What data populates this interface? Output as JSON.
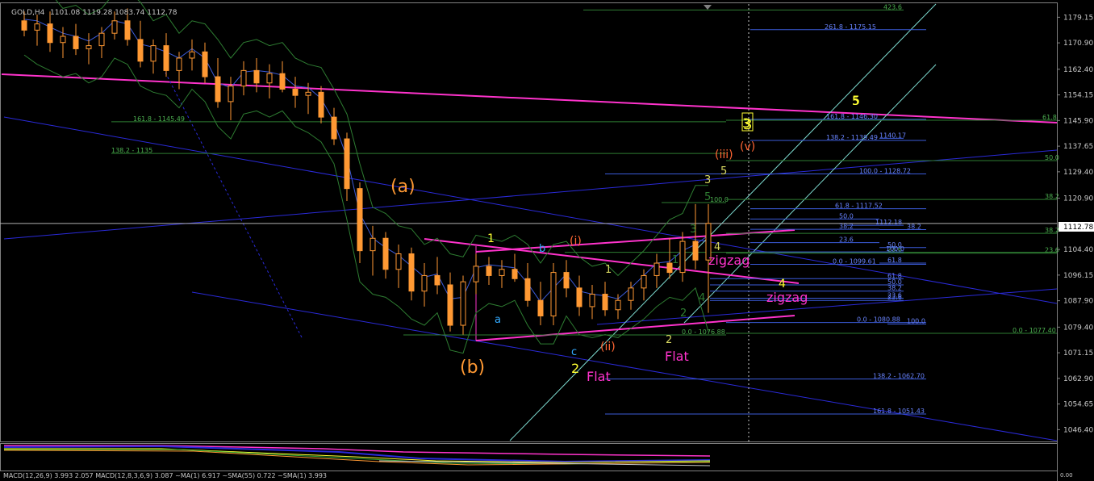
{
  "header": {
    "symbol": "GOLD,H4",
    "ohlc": "1101.08 1119.28 1083.74 1112.78"
  },
  "indicator_label": "MACD(12,26,9) 3.993 2.057  MACD(12,8,3,6,9) 3.087  ~MA(1) 6.917  ~SMA(55) 0.722  ~SMA(1) 3.993",
  "colors": {
    "background": "#000000",
    "candle_up": "#ff9933",
    "candle_down": "#ff9933",
    "magenta": "#ff33cc",
    "blue": "#2a2ad8",
    "fib_green": "#2e7d32",
    "fib_blue": "#3b5bd9",
    "axis_text": "#c8c8c8",
    "current_price_line": "#b0b0b0",
    "channel": "#7ddbd0",
    "yellow": "#ffff33",
    "orange": "#ff9933",
    "orange_red": "#ff6633",
    "cyan": "#33aaff"
  },
  "chart_data": {
    "type": "candlestick",
    "title": "GOLD,H4",
    "ylim": [
      1042.6,
      1183.4
    ],
    "y_ticks": [
      "1179.15",
      "1170.90",
      "1162.40",
      "1154.15",
      "1145.90",
      "1137.65",
      "1129.40",
      "1120.90",
      "1104.40",
      "1096.15",
      "1087.90",
      "1079.40",
      "1071.15",
      "1062.90",
      "1054.65",
      "1046.40"
    ],
    "current_price": "1112.78",
    "candles": [
      {
        "o": 1178,
        "h": 1181,
        "l": 1173,
        "c": 1175
      },
      {
        "o": 1175,
        "h": 1180,
        "l": 1170,
        "c": 1177
      },
      {
        "o": 1177,
        "h": 1181,
        "l": 1168,
        "c": 1171
      },
      {
        "o": 1171,
        "h": 1176,
        "l": 1166,
        "c": 1173
      },
      {
        "o": 1173,
        "h": 1177,
        "l": 1167,
        "c": 1169
      },
      {
        "o": 1169,
        "h": 1174,
        "l": 1164,
        "c": 1170
      },
      {
        "o": 1170,
        "h": 1176,
        "l": 1166,
        "c": 1174
      },
      {
        "o": 1174,
        "h": 1181,
        "l": 1172,
        "c": 1178
      },
      {
        "o": 1178,
        "h": 1182,
        "l": 1170,
        "c": 1172
      },
      {
        "o": 1172,
        "h": 1178,
        "l": 1163,
        "c": 1165
      },
      {
        "o": 1165,
        "h": 1172,
        "l": 1161,
        "c": 1170
      },
      {
        "o": 1170,
        "h": 1174,
        "l": 1160,
        "c": 1162
      },
      {
        "o": 1162,
        "h": 1168,
        "l": 1156,
        "c": 1166
      },
      {
        "o": 1166,
        "h": 1172,
        "l": 1162,
        "c": 1168
      },
      {
        "o": 1168,
        "h": 1171,
        "l": 1158,
        "c": 1160
      },
      {
        "o": 1160,
        "h": 1166,
        "l": 1150,
        "c": 1152
      },
      {
        "o": 1152,
        "h": 1160,
        "l": 1146,
        "c": 1157
      },
      {
        "o": 1157,
        "h": 1165,
        "l": 1154,
        "c": 1162
      },
      {
        "o": 1162,
        "h": 1166,
        "l": 1155,
        "c": 1158
      },
      {
        "o": 1158,
        "h": 1164,
        "l": 1153,
        "c": 1161
      },
      {
        "o": 1161,
        "h": 1165,
        "l": 1155,
        "c": 1156
      },
      {
        "o": 1156,
        "h": 1160,
        "l": 1150,
        "c": 1154
      },
      {
        "o": 1154,
        "h": 1158,
        "l": 1148,
        "c": 1155
      },
      {
        "o": 1155,
        "h": 1157,
        "l": 1145,
        "c": 1147
      },
      {
        "o": 1147,
        "h": 1150,
        "l": 1138,
        "c": 1140
      },
      {
        "o": 1140,
        "h": 1142,
        "l": 1120,
        "c": 1124
      },
      {
        "o": 1124,
        "h": 1126,
        "l": 1100,
        "c": 1104
      },
      {
        "o": 1104,
        "h": 1112,
        "l": 1096,
        "c": 1108
      },
      {
        "o": 1108,
        "h": 1110,
        "l": 1095,
        "c": 1098
      },
      {
        "o": 1098,
        "h": 1106,
        "l": 1092,
        "c": 1103
      },
      {
        "o": 1103,
        "h": 1105,
        "l": 1088,
        "c": 1091
      },
      {
        "o": 1091,
        "h": 1100,
        "l": 1086,
        "c": 1096
      },
      {
        "o": 1096,
        "h": 1102,
        "l": 1090,
        "c": 1093
      },
      {
        "o": 1093,
        "h": 1097,
        "l": 1078,
        "c": 1080
      },
      {
        "o": 1080,
        "h": 1096,
        "l": 1077,
        "c": 1094
      },
      {
        "o": 1094,
        "h": 1103,
        "l": 1090,
        "c": 1099
      },
      {
        "o": 1099,
        "h": 1102,
        "l": 1093,
        "c": 1096
      },
      {
        "o": 1096,
        "h": 1101,
        "l": 1092,
        "c": 1098
      },
      {
        "o": 1098,
        "h": 1103,
        "l": 1094,
        "c": 1095
      },
      {
        "o": 1095,
        "h": 1100,
        "l": 1086,
        "c": 1088
      },
      {
        "o": 1088,
        "h": 1094,
        "l": 1080,
        "c": 1083
      },
      {
        "o": 1083,
        "h": 1100,
        "l": 1080,
        "c": 1097
      },
      {
        "o": 1097,
        "h": 1101,
        "l": 1089,
        "c": 1092
      },
      {
        "o": 1092,
        "h": 1096,
        "l": 1083,
        "c": 1086
      },
      {
        "o": 1086,
        "h": 1093,
        "l": 1082,
        "c": 1090
      },
      {
        "o": 1090,
        "h": 1094,
        "l": 1083,
        "c": 1085
      },
      {
        "o": 1085,
        "h": 1090,
        "l": 1082,
        "c": 1088
      },
      {
        "o": 1088,
        "h": 1094,
        "l": 1085,
        "c": 1092
      },
      {
        "o": 1092,
        "h": 1098,
        "l": 1088,
        "c": 1096
      },
      {
        "o": 1096,
        "h": 1103,
        "l": 1092,
        "c": 1100
      },
      {
        "o": 1100,
        "h": 1108,
        "l": 1095,
        "c": 1097
      },
      {
        "o": 1097,
        "h": 1110,
        "l": 1094,
        "c": 1107
      },
      {
        "o": 1107,
        "h": 1119,
        "l": 1098,
        "c": 1101
      },
      {
        "o": 1101,
        "h": 1119,
        "l": 1084,
        "c": 1112.78
      }
    ],
    "fib_levels_green": [
      {
        "label": "423.6",
        "value": 1181.5
      },
      {
        "label": "161.8 - 1145.49",
        "value": 1145.49
      },
      {
        "label": "138.2 - 1135",
        "value": 1135.3
      },
      {
        "label": "100.0",
        "value": 1119.5
      },
      {
        "label": "38.2",
        "value": 1109.6
      },
      {
        "label": "23.6",
        "value": 1103.2
      },
      {
        "label": "0.0 - 1076.88",
        "value": 1076.88
      },
      {
        "label": "0.0 - 1077.40",
        "value": 1077.4
      },
      {
        "label": "61.8",
        "value": 1146.0
      },
      {
        "label": "50.0",
        "value": 1133.0
      },
      {
        "label": "38.2",
        "value": 1120.5
      },
      {
        "label": "23.6",
        "value": 1103.5
      }
    ],
    "fib_levels_blue": [
      {
        "label": "261.8 - 1175.15",
        "value": 1175.15
      },
      {
        "label": "161.8 - 1146.30",
        "value": 1146.3
      },
      {
        "label": "138.2 - 1139.49",
        "value": 1139.49
      },
      {
        "label": "100.0 - 1128.72",
        "value": 1128.72
      },
      {
        "label": "61.8 - 1117.52",
        "value": 1117.52
      },
      {
        "label": "50.0",
        "value": 1114.2
      },
      {
        "label": "38.2",
        "value": 1110.9
      },
      {
        "label": "23.6",
        "value": 1106.6
      },
      {
        "label": "0.0 - 1099.61",
        "value": 1099.61
      },
      {
        "label": "0.0 - 1080.88",
        "value": 1080.88
      },
      {
        "label": "138.2 - 1062.70",
        "value": 1062.7
      },
      {
        "label": "161.8 - 1051.43",
        "value": 1051.43
      },
      {
        "label": "100.0",
        "value": 1080.4
      },
      {
        "label": "1140.17",
        "value": 1140.17
      },
      {
        "label": "1112.18",
        "value": 1112.18
      },
      {
        "label": "38.2",
        "value": 1110.8
      },
      {
        "label": "50.0",
        "value": 1105.0
      },
      {
        "label": "61.8",
        "value": 1100.0
      },
      {
        "label": "61.8",
        "value": 1095.0
      },
      {
        "label": "50.0",
        "value": 1093.0
      },
      {
        "label": "38.2",
        "value": 1091.0
      },
      {
        "label": "23.6",
        "value": 1088.0
      },
      {
        "label": "23.6",
        "value": 1088.7
      },
      {
        "label": "100.0",
        "value": 1103.6
      }
    ],
    "wave_labels": [
      {
        "text": "(a)",
        "color": "#ff9933"
      },
      {
        "text": "(b)",
        "color": "#ff9933"
      },
      {
        "text": "1",
        "color": "#ffff33"
      },
      {
        "text": "2",
        "color": "#ffff33"
      },
      {
        "text": "3",
        "color": "#ffff33"
      },
      {
        "text": "4",
        "color": "#ffff33"
      },
      {
        "text": "5",
        "color": "#ffff33"
      },
      {
        "text": "a",
        "color": "#33aaff"
      },
      {
        "text": "b",
        "color": "#33aaff"
      },
      {
        "text": "c",
        "color": "#33aaff"
      },
      {
        "text": "(i)",
        "color": "#ff6633"
      },
      {
        "text": "(ii)",
        "color": "#ff6633"
      },
      {
        "text": "(iii)",
        "color": "#ff6633"
      },
      {
        "text": "(v)",
        "color": "#ff6633"
      },
      {
        "text": "Flat",
        "color": "#ff33cc"
      },
      {
        "text": "Flat",
        "color": "#ff33cc"
      },
      {
        "text": "zigzag",
        "color": "#ff33cc"
      },
      {
        "text": "zigzag",
        "color": "#ff33cc"
      },
      {
        "text": "1",
        "color": "#d8d860"
      },
      {
        "text": "2",
        "color": "#d8d860"
      },
      {
        "text": "3",
        "color": "#d8d860"
      },
      {
        "text": "4",
        "color": "#d8d860"
      },
      {
        "text": "5",
        "color": "#d8d860"
      },
      {
        "text": "1",
        "color": "#2e7d32"
      },
      {
        "text": "2",
        "color": "#2e7d32"
      },
      {
        "text": "3",
        "color": "#2e7d32"
      },
      {
        "text": "4",
        "color": "#2e7d32"
      },
      {
        "text": "5",
        "color": "#2e7d32"
      },
      {
        "text": "3",
        "color": "#ffff33"
      },
      {
        "text": "5",
        "color": "#ffff33"
      }
    ]
  }
}
